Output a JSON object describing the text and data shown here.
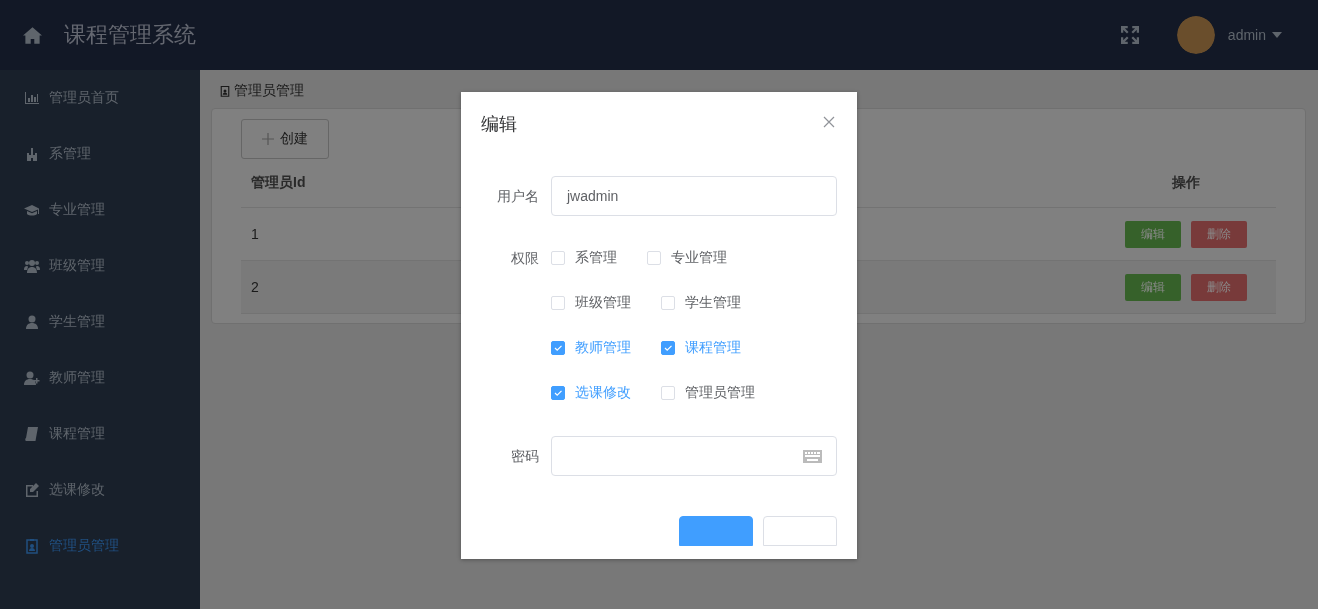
{
  "header": {
    "title": "课程管理系统",
    "user": "admin"
  },
  "sidebar": {
    "items": [
      {
        "label": "管理员首页",
        "selected": false
      },
      {
        "label": "系管理",
        "selected": false
      },
      {
        "label": "专业管理",
        "selected": false
      },
      {
        "label": "班级管理",
        "selected": false
      },
      {
        "label": "学生管理",
        "selected": false
      },
      {
        "label": "教师管理",
        "selected": false
      },
      {
        "label": "课程管理",
        "selected": false
      },
      {
        "label": "选课修改",
        "selected": false
      },
      {
        "label": "管理员管理",
        "selected": true
      }
    ]
  },
  "breadcrumb": "管理员管理",
  "create_button": "创建",
  "table": {
    "columns": [
      "管理员Id",
      "操作"
    ],
    "rows": [
      {
        "id": "1",
        "actions": [
          {
            "kind": "edit",
            "label": "编辑"
          },
          {
            "kind": "delete",
            "label": "删除"
          }
        ]
      },
      {
        "id": "2",
        "actions": [
          {
            "kind": "edit",
            "label": "编辑"
          },
          {
            "kind": "delete",
            "label": "删除"
          }
        ]
      }
    ]
  },
  "dialog": {
    "title": "编辑",
    "fields": [
      {
        "kind": "text",
        "label": "用户名",
        "value": "jwadmin"
      },
      {
        "kind": "checkboxes",
        "label": "权限",
        "options": [
          {
            "label": "系管理",
            "checked": false
          },
          {
            "label": "专业管理",
            "checked": false
          },
          {
            "label": "班级管理",
            "checked": false
          },
          {
            "label": "学生管理",
            "checked": false
          },
          {
            "label": "教师管理",
            "checked": true
          },
          {
            "label": "课程管理",
            "checked": true
          },
          {
            "label": "选课修改",
            "checked": true
          },
          {
            "label": "管理员管理",
            "checked": false
          }
        ]
      },
      {
        "kind": "password",
        "label": "密码"
      }
    ],
    "buttons": [
      {
        "kind": "primary"
      },
      {
        "kind": "default"
      }
    ]
  }
}
